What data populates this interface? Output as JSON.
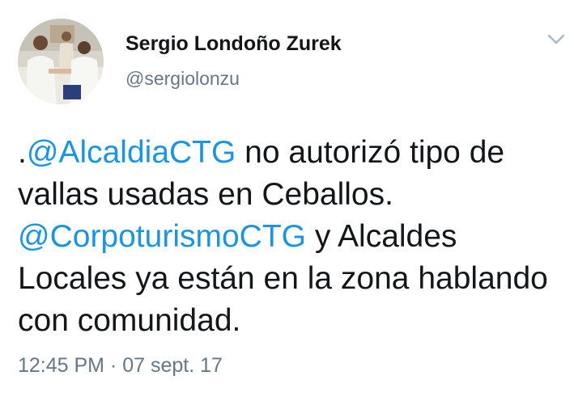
{
  "author": {
    "name": "Sergio Londoño Zurek",
    "handle": "@sergiolonzu"
  },
  "tweet": {
    "lead": ".",
    "mention_1": "@AlcaldiaCTG",
    "text_1": " no autorizó tipo de vallas usadas en Ceballos. ",
    "mention_2": "@CorpoturismoCTG",
    "text_2": " y Alcaldes Locales ya están en la zona hablando con comunidad."
  },
  "meta": {
    "time": "12:45 PM",
    "separator": " · ",
    "date": "07 sept. 17"
  },
  "icons": {
    "menu": "chevron-down-icon",
    "avatar": "profile-photo"
  },
  "colors": {
    "link": "#1b95e0",
    "text": "#14171a",
    "secondary": "#657786"
  }
}
